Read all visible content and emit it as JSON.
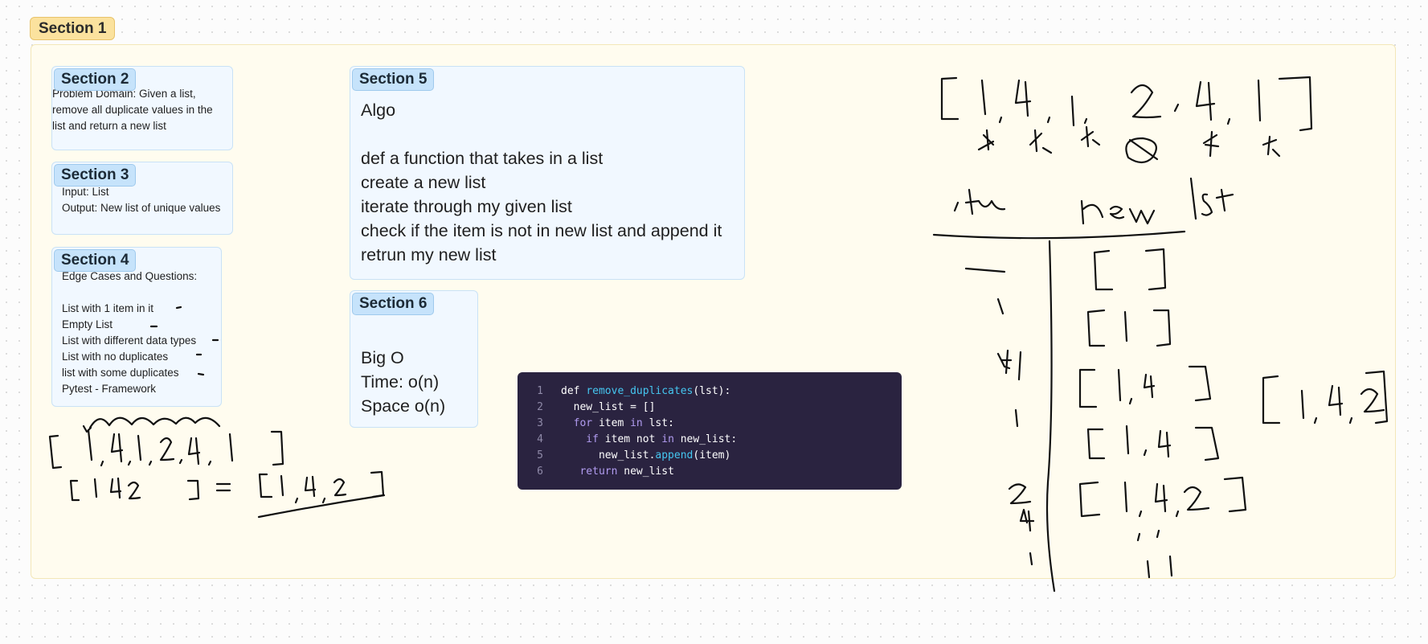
{
  "section1": {
    "label": "Section 1"
  },
  "section2": {
    "label": "Section 2",
    "lines": [
      "Problem Domain: Given a list,",
      "remove all duplicate values in the",
      "list and return a new list"
    ]
  },
  "section3": {
    "label": "Section 3",
    "lines": [
      "Input: List",
      "Output: New list of unique values"
    ]
  },
  "section4": {
    "label": "Section 4",
    "lines": [
      "Edge Cases and Questions:",
      "",
      "List with 1 item in it",
      "Empty List",
      "List with different data types",
      "List with no duplicates",
      "list with some duplicates",
      "Pytest - Framework"
    ]
  },
  "section5": {
    "label": "Section 5",
    "lines": [
      "Algo",
      "",
      "def a function that takes in a list",
      "create a new list",
      "iterate through my given list",
      "check if the item is not in new list and append it",
      "retrun my new list"
    ]
  },
  "section6": {
    "label": "Section 6",
    "lines": [
      "",
      "Big O",
      "Time: o(n)",
      "Space o(n)"
    ]
  },
  "code": {
    "line_numbers": [
      "1",
      "2",
      "3",
      "4",
      "5",
      "6"
    ],
    "l1": {
      "kw": "def",
      "fn": "remove_duplicates",
      "rest": "(lst):"
    },
    "l2": {
      "text": "  new_list = []"
    },
    "l3": {
      "kw": "  for",
      "mid": " item ",
      "kw2": "in",
      "rest": " lst:"
    },
    "l4": {
      "kw": "    if",
      "mid": " item not ",
      "kw2": "in",
      "rest": " new_list:"
    },
    "l5": {
      "pre": "      new_list.",
      "fn": "append",
      "rest": "(item)"
    },
    "l6": {
      "kw": "   return",
      "rest": " new_list"
    }
  },
  "colors": {
    "section_frame_bg": "#fffcef",
    "section_tab_bg": "#fbe29e",
    "card_bg": "#f1f8ff",
    "card_tab_bg": "#c6e3fb",
    "code_bg": "#2a2340",
    "code_fn": "#45c6f0",
    "code_kw": "#b19cf0"
  }
}
